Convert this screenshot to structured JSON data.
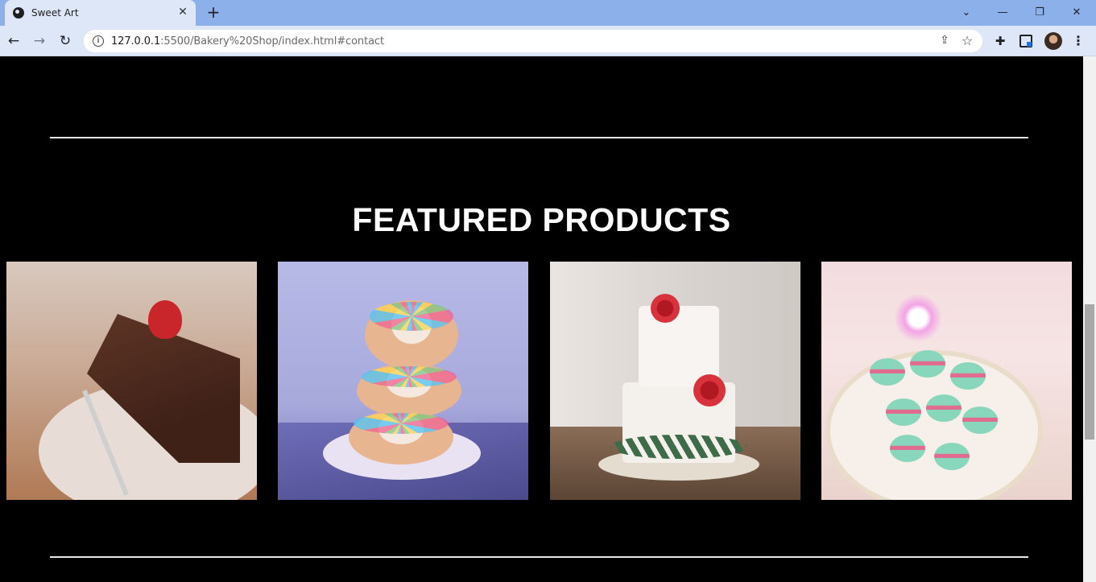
{
  "browser": {
    "tab_title": "Sweet Art",
    "tab_close": "✕",
    "new_tab": "+",
    "window_controls": {
      "dropdown": "⌄",
      "minimize": "—",
      "restore": "❐",
      "close": "✕"
    },
    "nav": {
      "back": "←",
      "forward": "→",
      "reload": "↻"
    },
    "url_host": "127.0.0.1",
    "url_rest": ":5500/Bakery%20Shop/index.html#contact",
    "icons": [
      "info-icon",
      "share-icon",
      "star-icon",
      "extensions-icon",
      "side-panel-icon",
      "profile-avatar",
      "menu-icon"
    ],
    "share_glyph": "⇪",
    "star_glyph": "☆",
    "ext_glyph": "✚",
    "menu_glyph": "⋮",
    "info_glyph": "i"
  },
  "page": {
    "section_title": "FEATURED PRODUCTS",
    "products": [
      {
        "name": "chocolate-cake-slice"
      },
      {
        "name": "sprinkle-donut-stack"
      },
      {
        "name": "floral-wedding-cake"
      },
      {
        "name": "macarons-plate"
      }
    ],
    "colors": {
      "background": "#000000",
      "divider": "#e6e6e6",
      "title": "#ffffff"
    }
  }
}
